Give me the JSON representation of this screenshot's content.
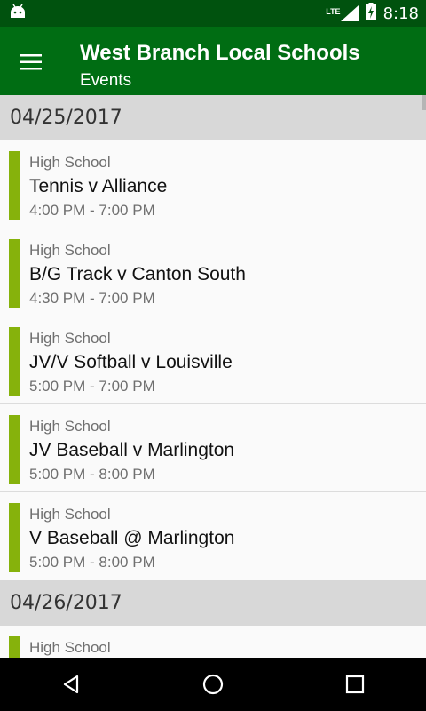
{
  "status_bar": {
    "network_label": "LTE",
    "time": "8:18",
    "icons": [
      "android-icon",
      "lte-signal-icon",
      "battery-charging-icon"
    ]
  },
  "app_bar": {
    "title": "West Branch Local Schools",
    "subtitle": "Events",
    "menu_icon": "hamburger-menu-icon"
  },
  "colors": {
    "status_bar": "#00520e",
    "app_bar": "#006d13",
    "event_accent": "#86b20c",
    "date_header_bg": "#d8d8d8"
  },
  "groups": [
    {
      "date": "04/25/2017",
      "events": [
        {
          "category": "High School",
          "title": "Tennis v Alliance",
          "time": "4:00 PM - 7:00 PM"
        },
        {
          "category": "High School",
          "title": "B/G Track v Canton South",
          "time": "4:30 PM - 7:00 PM"
        },
        {
          "category": "High School",
          "title": "JV/V Softball v Louisville",
          "time": "5:00 PM - 7:00 PM"
        },
        {
          "category": "High School",
          "title": "JV Baseball v Marlington",
          "time": "5:00 PM - 8:00 PM"
        },
        {
          "category": "High School",
          "title": "V Baseball @ Marlington",
          "time": "5:00 PM - 8:00 PM"
        }
      ]
    },
    {
      "date": "04/26/2017",
      "events": [
        {
          "category": "High School",
          "title": "",
          "time": ""
        }
      ]
    }
  ],
  "nav_bar": {
    "icons": [
      "back-icon",
      "home-icon",
      "recents-icon"
    ]
  }
}
